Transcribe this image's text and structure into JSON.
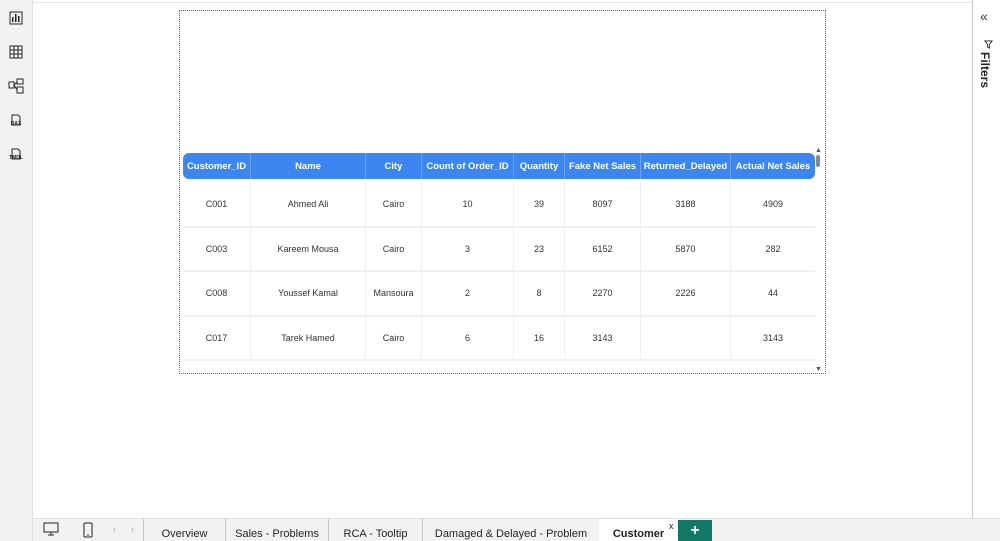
{
  "left_rail": {
    "icons": [
      "report-view-icon",
      "table-view-icon",
      "model-view-icon",
      "dax-query-icon",
      "tmdl-view-icon"
    ],
    "dax_label": "DAX",
    "tmdl_label": "TMDL"
  },
  "table": {
    "columns": [
      "Customer_ID",
      "Name",
      "City",
      "Count of Order_ID",
      "Quantity",
      "Fake Net Sales",
      "Returned_Delayed",
      "Actual Net Sales"
    ],
    "rows": [
      [
        "C001",
        "Ahmed Ali",
        "Cairo",
        "10",
        "39",
        "8097",
        "3188",
        "4909"
      ],
      [
        "C003",
        "Kareem Mousa",
        "Cairo",
        "3",
        "23",
        "6152",
        "5870",
        "282"
      ],
      [
        "C008",
        "Youssef Kamal",
        "Mansoura",
        "2",
        "8",
        "2270",
        "2226",
        "44"
      ],
      [
        "C017",
        "Tarek Hamed",
        "Cairo",
        "6",
        "16",
        "3143",
        "",
        "3143"
      ]
    ],
    "header_color": "#3b86f0"
  },
  "right_pane": {
    "collapse_icon": "double-chevron-left-icon",
    "filter_icon": "filter-icon",
    "label": "Filters"
  },
  "tabs": {
    "items": [
      "Overview",
      "Sales - Problems",
      "RCA - Tooltip",
      "Damaged & Delayed - Problem",
      "Customer"
    ],
    "active_index": 4,
    "close_label": "x",
    "add_label": "+",
    "add_color": "#117865"
  }
}
